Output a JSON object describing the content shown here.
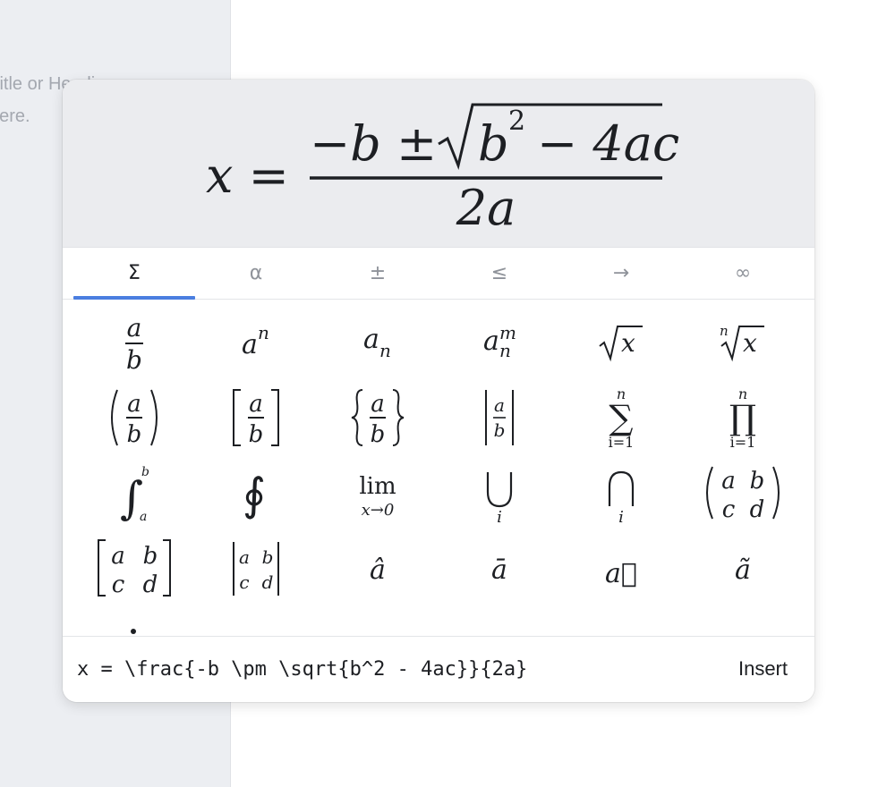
{
  "sidebar": {
    "hint_line1": "Title or Heading",
    "hint_line2": "here."
  },
  "preview": {
    "latex": "x = \\frac{-b \\pm \\sqrt{b^2 - 4ac}}{2a}",
    "lhs": "x =",
    "numerator_left": "−b ±",
    "numerator_radicand": "b",
    "numerator_exponent": "2",
    "numerator_rest": "− 4ac",
    "denominator": "2a"
  },
  "tabs": [
    {
      "label": "Σ",
      "name": "operators",
      "active": true
    },
    {
      "label": "α",
      "name": "greek",
      "active": false
    },
    {
      "label": "±",
      "name": "binary",
      "active": false
    },
    {
      "label": "≤",
      "name": "relations",
      "active": false
    },
    {
      "label": "→",
      "name": "arrows",
      "active": false
    },
    {
      "label": "∞",
      "name": "misc",
      "active": false
    }
  ],
  "templates": [
    {
      "name": "fraction",
      "latex": "\\frac{a}{b}"
    },
    {
      "name": "superscript",
      "latex": "a^{n}"
    },
    {
      "name": "subscript",
      "latex": "a_{n}"
    },
    {
      "name": "sub-superscript",
      "latex": "a_{n}^{m}"
    },
    {
      "name": "square-root",
      "latex": "\\sqrt{x}"
    },
    {
      "name": "nth-root",
      "latex": "\\sqrt[n]{x}"
    },
    {
      "name": "paren-fraction",
      "latex": "\\left(\\frac{a}{b}\\right)"
    },
    {
      "name": "bracket-fraction",
      "latex": "\\left[\\frac{a}{b}\\right]"
    },
    {
      "name": "brace-fraction",
      "latex": "\\left\\{\\frac{a}{b}\\right\\}"
    },
    {
      "name": "abs-fraction",
      "latex": "\\left|\\frac{a}{b}\\right|"
    },
    {
      "name": "summation",
      "latex": "\\sum_{i=1}^{n}"
    },
    {
      "name": "product",
      "latex": "\\prod_{i=1}^{n}"
    },
    {
      "name": "definite-integral",
      "latex": "\\int_{a}^{b}"
    },
    {
      "name": "contour-integral",
      "latex": "\\oint"
    },
    {
      "name": "limit",
      "latex": "\\lim_{x\\to 0}"
    },
    {
      "name": "union",
      "latex": "\\bigcup_{i}"
    },
    {
      "name": "intersection",
      "latex": "\\bigcap_{i}"
    },
    {
      "name": "pmatrix",
      "latex": "\\begin{pmatrix}a&b\\\\c&d\\end{pmatrix}"
    },
    {
      "name": "bmatrix",
      "latex": "\\begin{bmatrix}a&b\\\\c&d\\end{bmatrix}"
    },
    {
      "name": "vmatrix",
      "latex": "\\begin{vmatrix}a&b\\\\c&d\\end{vmatrix}"
    },
    {
      "name": "hat",
      "latex": "\\hat{a}"
    },
    {
      "name": "bar",
      "latex": "\\bar{a}"
    },
    {
      "name": "vector",
      "latex": "\\vec{a}"
    },
    {
      "name": "tilde",
      "latex": "\\tilde{a}"
    }
  ],
  "glyphs": {
    "a": "a",
    "b": "b",
    "c": "c",
    "d": "d",
    "n": "n",
    "m": "m",
    "x": "x",
    "i": "i",
    "i_eq_1": "i=1",
    "lim": "lim",
    "x_to_0": "x→0",
    "sigma": "∑",
    "pi": "∏",
    "integral": "∫",
    "oint": "∮",
    "cup": "⋃",
    "cap": "⋂",
    "hat_a": "â",
    "bar_a": "ā",
    "vec_a": "a⃗",
    "tilde_a": "ã"
  },
  "input": {
    "value": "x = \\frac{-b \\pm \\sqrt{b^2 - 4ac}}{2a}",
    "placeholder": ""
  },
  "actions": {
    "insert_label": "Insert"
  },
  "colors": {
    "accent": "#4a7ee0",
    "preview_bg": "#ebecef",
    "sidebar_bg": "#eceef2"
  }
}
